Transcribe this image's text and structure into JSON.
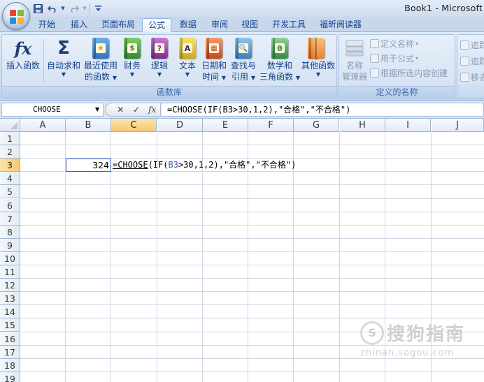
{
  "window": {
    "title": "Book1 - Microsoft"
  },
  "quick_access": {
    "items": [
      "save-icon",
      "undo-icon",
      "redo-icon",
      "customize-icon"
    ]
  },
  "tabs": [
    "开始",
    "插入",
    "页面布局",
    "公式",
    "数据",
    "审阅",
    "视图",
    "开发工具",
    "福昕阅读器"
  ],
  "active_tab": "公式",
  "ribbon": {
    "function_library": {
      "label": "函数库",
      "insert_function": "插入函数",
      "fx_glyph": "fx",
      "autosum": "自动求和",
      "sigma_glyph": "Σ",
      "recent_line1": "最近使用",
      "recent_line2": "的函数",
      "financial": "财务",
      "logical": "逻辑",
      "logical_glyph": "?",
      "text": "文本",
      "text_glyph": "A",
      "datetime_line1": "日期和",
      "datetime_line2": "时间",
      "lookup_line1": "查找与",
      "lookup_line2": "引用",
      "math_line1": "数学和",
      "math_line2": "三角函数",
      "math_glyph": "θ",
      "more": "其他函数"
    },
    "defined_names": {
      "label": "定义的名称",
      "name_manager_line1": "名称",
      "name_manager_line2": "管理器",
      "define_name": "定义名称",
      "use_in_formula": "用于公式",
      "create_from_selection": "根据所选内容创建"
    },
    "formula_auditing": {
      "item1": "追踪",
      "item2": "追踪",
      "item3": "移去"
    }
  },
  "formula_bar": {
    "name_box": "CHOOSE",
    "cancel_glyph": "✕",
    "enter_glyph": "✓",
    "fx_glyph": "fx",
    "formula": "=CHOOSE(IF(B3>30,1,2),\"合格\",\"不合格\")"
  },
  "grid": {
    "columns": [
      "A",
      "B",
      "C",
      "D",
      "E",
      "F",
      "G",
      "H",
      "I",
      "J"
    ],
    "rows": [
      "1",
      "2",
      "3",
      "4",
      "5",
      "6",
      "7",
      "8",
      "9",
      "10",
      "11",
      "12",
      "13",
      "14",
      "15",
      "16",
      "17",
      "18",
      "19"
    ],
    "selected_column": "C",
    "selected_row": "3",
    "cells": {
      "B3": "324",
      "C3_parts": [
        "=CHOOSE",
        "(IF(",
        "B3",
        ">30,1,2),\"合格\",\"不合格\")"
      ]
    }
  },
  "watermark": {
    "name": "搜狗指南",
    "url": "zhinan.sogou.com",
    "logo_glyph": "S"
  },
  "colors": {
    "accent": "#15428b",
    "selection_header": "#f8c970",
    "cell_border": "#3c5cc7"
  }
}
